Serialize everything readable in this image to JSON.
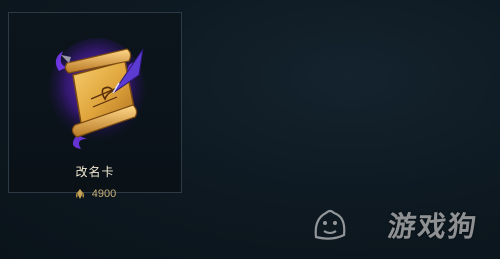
{
  "store_item": {
    "name": "改名卡",
    "price": "4900",
    "currency_icon": "blue-essence-icon",
    "art_icon": "name-change-scroll-icon"
  },
  "watermark": {
    "text": "游戏狗",
    "logo_icon": "game-dog-logo-icon"
  },
  "colors": {
    "background": "#0d1820",
    "card_border": "#2b3a44",
    "price_text": "#c7b07a",
    "scroll_gold": "#e0a53c",
    "magic_purple": "#7d3cff"
  }
}
